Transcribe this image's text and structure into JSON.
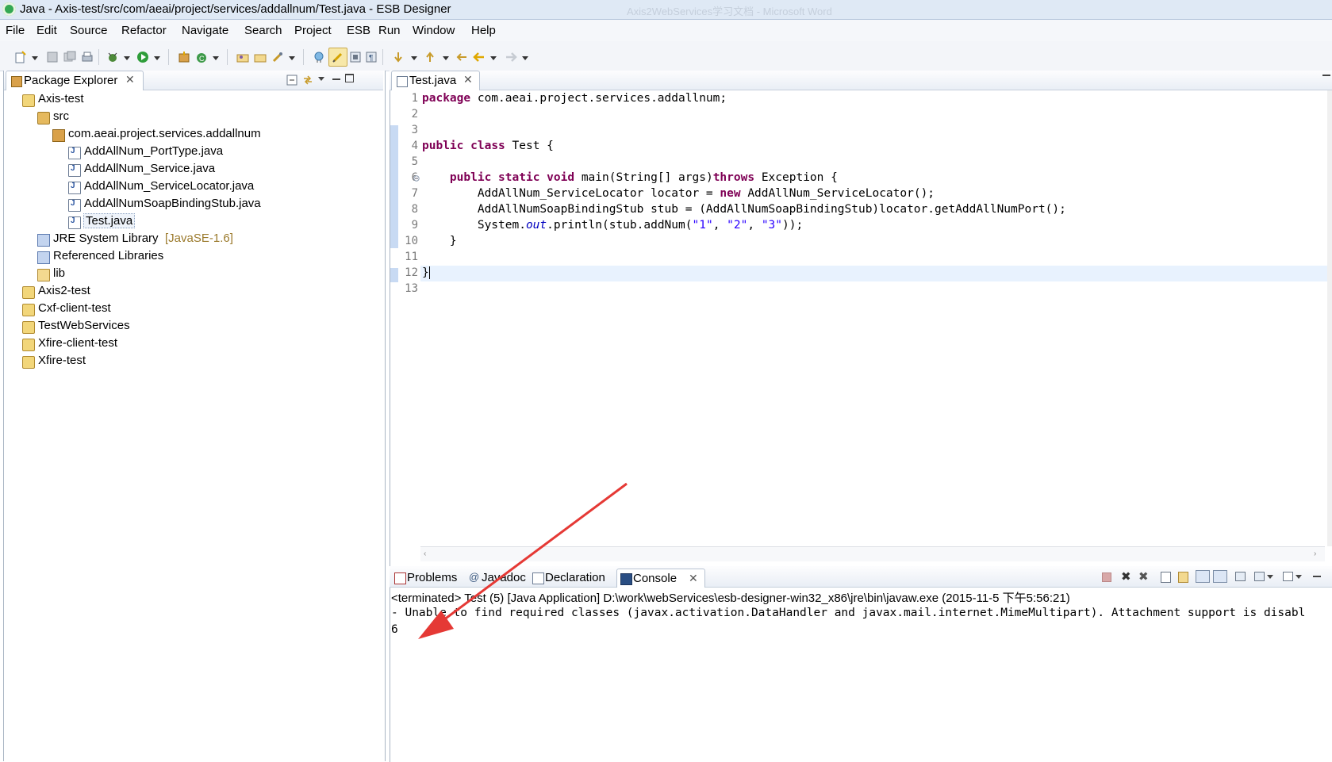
{
  "window": {
    "title": "Java - Axis-test/src/com/aeai/project/services/addallnum/Test.java - ESB Designer",
    "background_title": "Axis2WebServices学习文档 - Microsoft Word"
  },
  "menu": [
    "File",
    "Edit",
    "Source",
    "Refactor",
    "Navigate",
    "Search",
    "Project",
    "ESB",
    "Run",
    "Window",
    "Help"
  ],
  "package_explorer": {
    "tab_label": "Package Explorer",
    "tree": [
      {
        "label": "Axis-test",
        "icon": "project-icon"
      },
      {
        "label": "src",
        "icon": "source-folder-icon"
      },
      {
        "label": "com.aeai.project.services.addallnum",
        "icon": "package-icon"
      },
      {
        "label": "AddAllNum_PortType.java",
        "icon": "java-file-icon"
      },
      {
        "label": "AddAllNum_Service.java",
        "icon": "java-file-icon"
      },
      {
        "label": "AddAllNum_ServiceLocator.java",
        "icon": "java-file-icon"
      },
      {
        "label": "AddAllNumSoapBindingStub.java",
        "icon": "java-file-icon"
      },
      {
        "label": "Test.java",
        "icon": "java-file-icon"
      },
      {
        "label": "JRE System Library",
        "suffix": "[JavaSE-1.6]",
        "icon": "library-icon"
      },
      {
        "label": "Referenced Libraries",
        "icon": "library-icon"
      },
      {
        "label": "lib",
        "icon": "folder-icon"
      },
      {
        "label": "Axis2-test",
        "icon": "project-icon"
      },
      {
        "label": "Cxf-client-test",
        "icon": "project-icon"
      },
      {
        "label": "TestWebServices",
        "icon": "project-icon"
      },
      {
        "label": "Xfire-client-test",
        "icon": "project-icon"
      },
      {
        "label": "Xfire-test",
        "icon": "project-icon"
      }
    ]
  },
  "editor": {
    "tab_label": "Test.java",
    "line_numbers": [
      "1",
      "2",
      "3",
      "4",
      "5",
      "6",
      "7",
      "8",
      "9",
      "10",
      "11",
      "12",
      "13"
    ],
    "lines": {
      "l1_kw": "package",
      "l1_rest": " com.aeai.project.services.addallnum;",
      "l4_kw1": "public",
      "l4_kw2": "class",
      "l4_rest": " Test {",
      "l6_indent": "    ",
      "l6_kw1": "public",
      "l6_kw2": "static",
      "l6_kw3": "void",
      "l6_mid": " main(String[] args)",
      "l6_kw4": "throws",
      "l6_rest": " Exception {",
      "l7_pre": "        AddAllNum_ServiceLocator locator = ",
      "l7_kw": "new",
      "l7_rest": " AddAllNum_ServiceLocator();",
      "l8": "        AddAllNumSoapBindingStub stub = (AddAllNumSoapBindingStub)locator.getAddAllNumPort();",
      "l9_pre": "        System.",
      "l9_fld": "out",
      "l9_mid": ".println(stub.addNum(",
      "l9_s1": "\"1\"",
      "l9_c1": ", ",
      "l9_s2": "\"2\"",
      "l9_c2": ", ",
      "l9_s3": "\"3\"",
      "l9_end": "));",
      "l10": "    }",
      "l12": "}"
    }
  },
  "bottom_tabs": [
    "Problems",
    "Javadoc",
    "Declaration",
    "Console"
  ],
  "console": {
    "status": "<terminated> Test (5) [Java Application] D:\\work\\webServices\\esb-designer-win32_x86\\jre\\bin\\javaw.exe (2015-11-5 下午5:56:21)",
    "line1": "- Unable to find required classes (javax.activation.DataHandler and javax.mail.internet.MimeMultipart). Attachment support is disabl",
    "line2": "6"
  },
  "colors": {
    "keyword": "#7f0055",
    "string": "#2a00ff",
    "static_field": "#0000c0",
    "annotation_arrow": "#e53935"
  }
}
